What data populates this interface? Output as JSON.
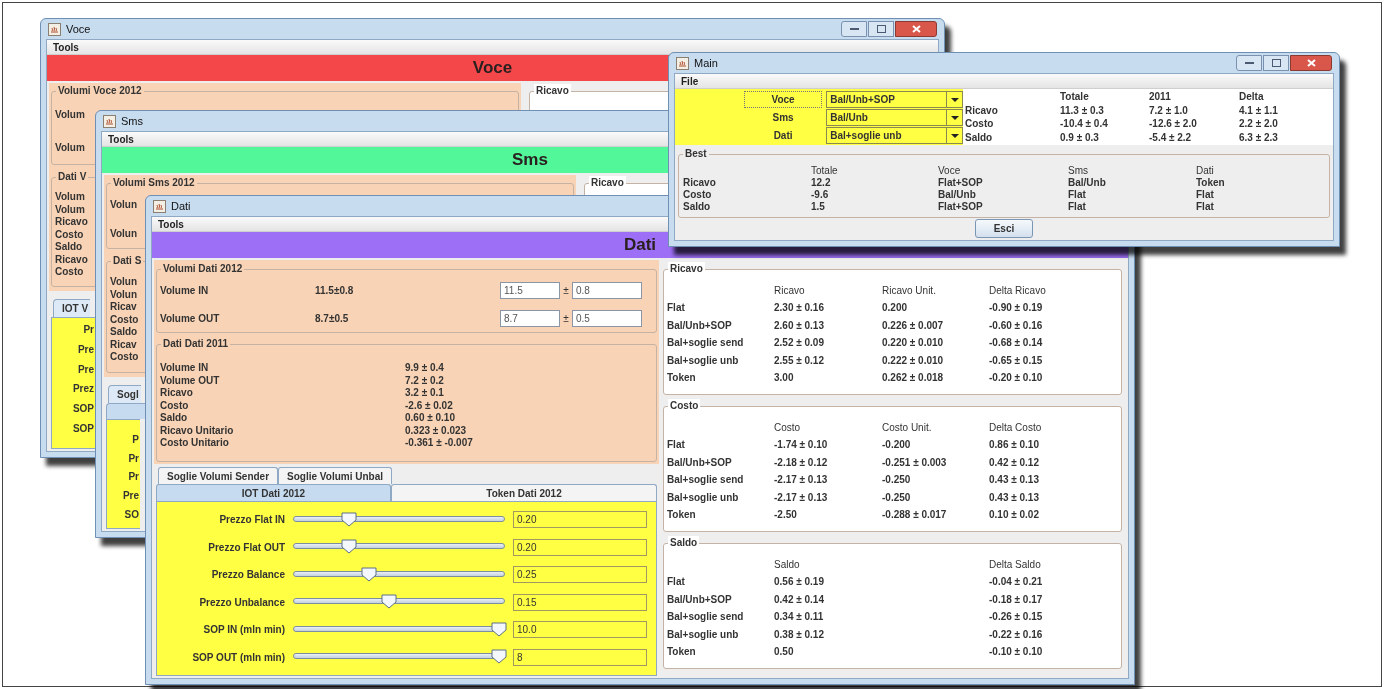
{
  "back_windows": [
    {
      "title": "Voce",
      "menu": [
        "Tools"
      ],
      "header": "Voce",
      "volumi_title": "Volumi Voce 2012",
      "ricavo_title": "Ricavo",
      "volumi_rows": [
        "Volum",
        "Volum"
      ],
      "dati_title": "Dati V",
      "dati_rows": [
        "Volum",
        "Volum",
        "Ricavo",
        "Costo",
        "Saldo",
        "Ricavo",
        "Costo"
      ],
      "tab": "IOT V",
      "slider_labels": [
        "Pr",
        "Pre",
        "Pre",
        "Prez",
        "SOP",
        "SOP"
      ]
    },
    {
      "title": "Sms",
      "menu": [
        "Tools"
      ],
      "header": "Sms",
      "volumi_title": "Volumi Sms 2012",
      "ricavo_title": "Ricavo",
      "volumi_rows": [
        "Volun",
        "Volun"
      ],
      "dati_title": "Dati S",
      "dati_rows": [
        "Volun",
        "Volun",
        "Ricav",
        "Costo",
        "Saldo",
        "Ricav",
        "Costo"
      ],
      "tab": "Sogl",
      "slider_labels": [
        "P",
        "Pr",
        "Pr",
        "Pre",
        "SO"
      ]
    }
  ],
  "dati_window": {
    "title": "Dati",
    "menu": [
      "Tools"
    ],
    "header": "Dati",
    "volumi_group": {
      "title": "Volumi Dati 2012",
      "rows": [
        {
          "label": "Volume IN",
          "estimate": "11.5±0.8",
          "value": "11.5",
          "sign": "±",
          "error": "0.8"
        },
        {
          "label": "Volume OUT",
          "estimate": "8.7±0.5",
          "value": "8.7",
          "sign": "±",
          "error": "0.5"
        }
      ]
    },
    "dati_2011_group": {
      "title": "Dati Dati 2011",
      "rows": [
        {
          "label": "Volume IN",
          "value": "9.9 ± 0.4"
        },
        {
          "label": "Volume OUT",
          "value": "7.2 ± 0.2"
        },
        {
          "label": "Ricavo",
          "value": "3.2 ± 0.1"
        },
        {
          "label": "Costo",
          "value": "-2.6 ± 0.02"
        },
        {
          "label": "Saldo",
          "value": "0.60 ± 0.10"
        },
        {
          "label": "Ricavo Unitario",
          "value": "0.323 ± 0.023"
        },
        {
          "label": "Costo Unitario",
          "value": "-0.361 ± -0.007"
        }
      ]
    },
    "tabs_row_1": [
      {
        "label": "Soglie Volumi Sender",
        "selected": false
      },
      {
        "label": "Soglie Volumi Unbal",
        "selected": false
      }
    ],
    "tabs_row_2": [
      {
        "label": "IOT Dati 2012",
        "selected": true
      },
      {
        "label": "Token Dati 2012",
        "selected": false
      }
    ],
    "sliders": [
      {
        "label": "Prezzo Flat IN",
        "level": 0.25,
        "value": "0.20"
      },
      {
        "label": "Prezzo Flat OUT",
        "level": 0.25,
        "value": "0.20"
      },
      {
        "label": "Prezzo Balance",
        "level": 0.35,
        "value": "0.25"
      },
      {
        "label": "Prezzo Unbalance",
        "level": 0.45,
        "value": "0.15"
      },
      {
        "label": "SOP IN (mln min)",
        "level": 1,
        "value": "10.0"
      },
      {
        "label": "SOP OUT (mln min)",
        "level": 1,
        "value": "8"
      }
    ],
    "result_groups": [
      {
        "title": "Ricavo",
        "columns": [
          "",
          "Ricavo",
          "Ricavo Unit.",
          "Delta Ricavo"
        ],
        "rows": [
          [
            "Flat",
            "2.30 ± 0.16",
            "0.200",
            "-0.90 ± 0.19"
          ],
          [
            "Bal/Unb+SOP",
            "2.60 ± 0.13",
            "0.226 ± 0.007",
            "-0.60 ± 0.16"
          ],
          [
            "Bal+soglie send",
            "2.52 ± 0.09",
            "0.220 ± 0.010",
            "-0.68 ± 0.14"
          ],
          [
            "Bal+soglie unb",
            "2.55 ± 0.12",
            "0.222 ± 0.010",
            "-0.65 ± 0.15"
          ],
          [
            "Token",
            "3.00",
            "0.262 ± 0.018",
            "-0.20 ± 0.10"
          ]
        ]
      },
      {
        "title": "Costo",
        "columns": [
          "",
          "Costo",
          "Costo Unit.",
          "Delta Costo"
        ],
        "rows": [
          [
            "Flat",
            "-1.74 ± 0.10",
            "-0.200",
            "0.86 ± 0.10"
          ],
          [
            "Bal/Unb+SOP",
            "-2.18 ± 0.12",
            "-0.251 ± 0.003",
            "0.42 ± 0.12"
          ],
          [
            "Bal+soglie send",
            "-2.17 ± 0.13",
            "-0.250",
            "0.43 ± 0.13"
          ],
          [
            "Bal+soglie unb",
            "-2.17 ± 0.13",
            "-0.250",
            "0.43 ± 0.13"
          ],
          [
            "Token",
            "-2.50",
            "-0.288 ± 0.017",
            "0.10 ± 0.02"
          ]
        ]
      },
      {
        "title": "Saldo",
        "columns": [
          "",
          "Saldo",
          "",
          "Delta Saldo"
        ],
        "rows": [
          [
            "Flat",
            "0.56 ± 0.19",
            "",
            "-0.04 ± 0.21"
          ],
          [
            "Bal/Unb+SOP",
            "0.42 ± 0.14",
            "",
            "-0.18 ± 0.17"
          ],
          [
            "Bal+soglie send",
            "0.34 ± 0.11",
            "",
            "-0.26 ± 0.15"
          ],
          [
            "Bal+soglie unb",
            "0.38 ± 0.12",
            "",
            "-0.22 ± 0.16"
          ],
          [
            "Token",
            "0.50",
            "",
            "-0.10 ± 0.10"
          ]
        ]
      }
    ]
  },
  "main_window": {
    "title": "Main",
    "menu": [
      "File"
    ],
    "selectors": [
      {
        "label": "Voce",
        "value": "Bal/Unb+SOP",
        "focused": true
      },
      {
        "label": "Sms",
        "value": "Bal/Unb",
        "focused": false
      },
      {
        "label": "Dati",
        "value": "Bal+soglie unb",
        "focused": false
      }
    ],
    "summary": {
      "columns": [
        "Totale",
        "2011",
        "Delta"
      ],
      "rows": [
        {
          "label": "Ricavo",
          "values": [
            "11.3 ± 0.3",
            "7.2 ± 1.0",
            "4.1 ± 1.1"
          ]
        },
        {
          "label": "Costo",
          "values": [
            "-10.4 ± 0.4",
            "-12.6 ± 2.0",
            "2.2 ± 2.0"
          ]
        },
        {
          "label": "Saldo",
          "values": [
            "0.9 ± 0.3",
            "-5.4 ± 2.2",
            "6.3 ± 2.3"
          ]
        }
      ]
    },
    "best": {
      "title": "Best",
      "columns": [
        "Totale",
        "Voce",
        "Sms",
        "Dati"
      ],
      "rows": [
        {
          "label": "Ricavo",
          "values": [
            "12.2",
            "Flat+SOP",
            "Bal/Unb",
            "Token"
          ]
        },
        {
          "label": "Costo",
          "values": [
            "-9.6",
            "Bal/Unb",
            "Flat",
            "Flat"
          ]
        },
        {
          "label": "Saldo",
          "values": [
            "1.5",
            "Flat+SOP",
            "Flat",
            "Flat"
          ]
        }
      ]
    },
    "button": "Esci"
  }
}
